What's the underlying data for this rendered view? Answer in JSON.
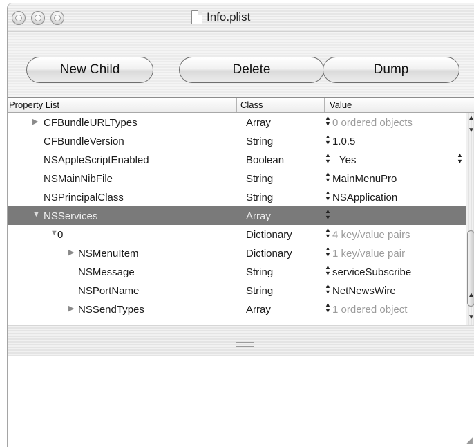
{
  "window": {
    "title": "Info.plist"
  },
  "toolbar": {
    "new_child": "New Child",
    "delete": "Delete",
    "dump": "Dump"
  },
  "table": {
    "headers": {
      "property_list": "Property List",
      "class": "Class",
      "value": "Value"
    },
    "rows": [
      {
        "key": "CFBundleURLTypes",
        "cls": "Array",
        "value": "0 ordered objects",
        "value_dim": true,
        "expander": "collapsed",
        "indent": 1,
        "selected": false
      },
      {
        "key": "CFBundleVersion",
        "cls": "String",
        "value": "1.0.5",
        "value_dim": false,
        "expander": "none",
        "indent": 1,
        "selected": false
      },
      {
        "key": "NSAppleScriptEnabled",
        "cls": "Boolean",
        "value": "Yes",
        "value_dim": false,
        "expander": "none",
        "indent": 1,
        "selected": false,
        "popup": true
      },
      {
        "key": "NSMainNibFile",
        "cls": "String",
        "value": "MainMenuPro",
        "value_dim": false,
        "expander": "none",
        "indent": 1,
        "selected": false
      },
      {
        "key": "NSPrincipalClass",
        "cls": "String",
        "value": "NSApplication",
        "value_dim": false,
        "expander": "none",
        "indent": 1,
        "selected": false
      },
      {
        "key": "NSServices",
        "cls": "Array",
        "value": "",
        "value_dim": false,
        "expander": "expanded",
        "indent": 1,
        "selected": true
      },
      {
        "key": "0",
        "cls": "Dictionary",
        "value": "4 key/value pairs",
        "value_dim": true,
        "expander": "expanded",
        "indent": 2,
        "selected": false
      },
      {
        "key": "NSMenuItem",
        "cls": "Dictionary",
        "value": "1 key/value pair",
        "value_dim": true,
        "expander": "collapsed",
        "indent": 3,
        "selected": false
      },
      {
        "key": "NSMessage",
        "cls": "String",
        "value": "serviceSubscribe",
        "value_dim": false,
        "expander": "none",
        "indent": 3,
        "selected": false
      },
      {
        "key": "NSPortName",
        "cls": "String",
        "value": "NetNewsWire",
        "value_dim": false,
        "expander": "none",
        "indent": 3,
        "selected": false
      },
      {
        "key": "NSSendTypes",
        "cls": "Array",
        "value": "1 ordered object",
        "value_dim": true,
        "expander": "collapsed",
        "indent": 3,
        "selected": false
      }
    ]
  }
}
